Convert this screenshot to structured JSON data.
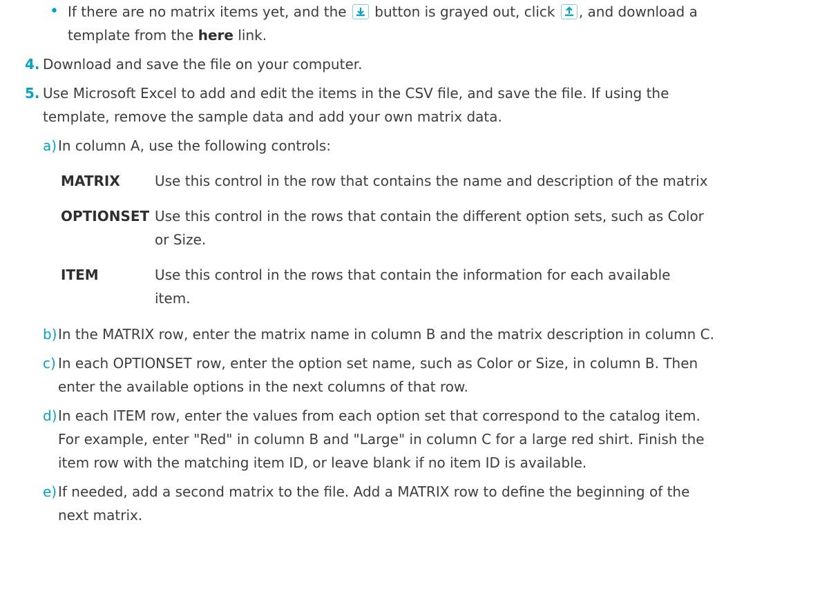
{
  "bullet": {
    "glyph": "•",
    "text1": "If there are no matrix items yet, and the",
    "text2": "button is grayed out, click",
    "text3": ", and download a",
    "text4": "template from the",
    "link": "here",
    "text5": "link.",
    "icons": [
      "download-icon",
      "upload-icon"
    ]
  },
  "steps": [
    {
      "number": "4.",
      "text": "Download and save the file on your computer."
    },
    {
      "number": "5.",
      "line1": "Use Microsoft Excel to add and edit the items in the CSV file, and save the file. If using the",
      "line2": "template, remove the sample data and add your own matrix data."
    }
  ],
  "substeps": {
    "a": {
      "letter": "a)",
      "text": "In column A, use the following controls:"
    },
    "b": {
      "letter": "b)",
      "text": "In the MATRIX row, enter the matrix name in column B and the matrix description in column C."
    },
    "c": {
      "letter": "c)",
      "line1": "In each OPTIONSET row, enter the option set name, such as Color or Size, in column B. Then",
      "line2": "enter the available options in the next columns of that row."
    },
    "d": {
      "letter": "d)",
      "line1": "In each ITEM row, enter the values from each option set that correspond to the catalog item.",
      "line2": "For example, enter \"Red\" in column B and \"Large\" in column C for a large red shirt. Finish the",
      "line3": "item row with the matching item ID, or leave blank if no item ID is available."
    },
    "e": {
      "letter": "e)",
      "line1": "If needed, add a second matrix to the file. Add a MATRIX row to define the beginning of the",
      "line2": "next matrix."
    }
  },
  "controls": [
    {
      "term": "MATRIX",
      "line1": "Use this control in the row that contains the name and description of the matrix"
    },
    {
      "term": "OPTIONSET",
      "line1": "Use this control in the rows that contain the different option sets, such as Color",
      "line2": "or Size."
    },
    {
      "term": "ITEM",
      "line1": "Use this control in the rows that contain the information for each available",
      "line2": "item."
    }
  ],
  "colors": {
    "accent": "#00a3c9",
    "text": "#3d3d3d"
  }
}
